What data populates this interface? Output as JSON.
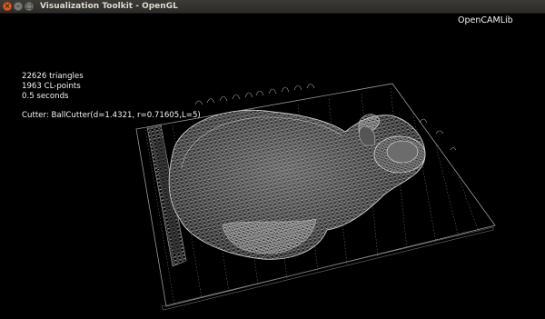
{
  "window": {
    "title": "Visualization Toolkit - OpenGL"
  },
  "overlay": {
    "logo": "OpenCAMLib",
    "stats": {
      "triangles": "22626 triangles",
      "cl_points": "1963 CL-points",
      "time": "0.5 seconds"
    },
    "cutter": "Cutter: BallCutter(d=1.4321, r=0.71605,L=5)"
  },
  "colors": {
    "background": "#000000",
    "text": "#f2f2f2",
    "mesh": "#bdbdbd",
    "titlebar": "#3c3b37",
    "close_button": "#e25a1f"
  },
  "icons": {
    "close": "close-icon",
    "minimize": "minimize-icon",
    "maximize": "maximize-icon"
  }
}
